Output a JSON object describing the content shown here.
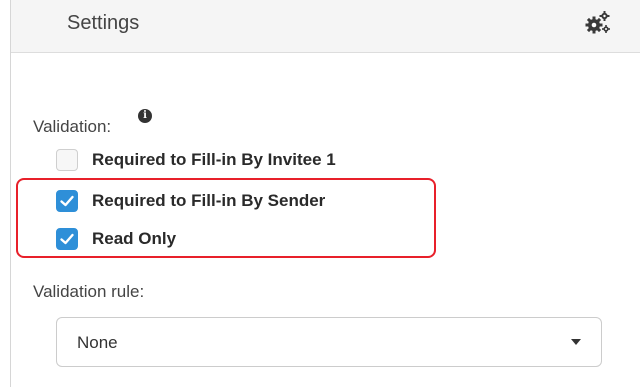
{
  "header": {
    "title": "Settings",
    "icon": "gears-icon"
  },
  "validation": {
    "label": "Validation:",
    "info_icon_glyph": "i",
    "options": [
      {
        "label": "Required to Fill-in By Invitee 1",
        "checked": false
      },
      {
        "label": "Required to Fill-in By Sender",
        "checked": true
      },
      {
        "label": "Read Only",
        "checked": true
      }
    ]
  },
  "validation_rule": {
    "label": "Validation rule:",
    "selected": "None"
  },
  "colors": {
    "checkbox_checked": "#2e8fd8",
    "highlight": "#e8202a"
  }
}
